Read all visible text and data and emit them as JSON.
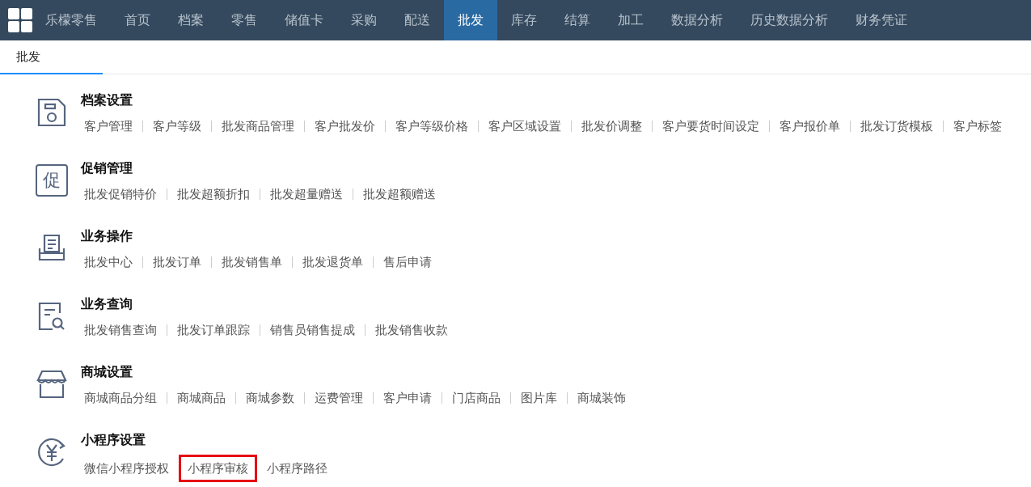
{
  "navbar": {
    "brand": "乐檬零售",
    "items": [
      {
        "label": "首页",
        "selected": false
      },
      {
        "label": "档案",
        "selected": false
      },
      {
        "label": "零售",
        "selected": false
      },
      {
        "label": "储值卡",
        "selected": false
      },
      {
        "label": "采购",
        "selected": false
      },
      {
        "label": "配送",
        "selected": false
      },
      {
        "label": "批发",
        "selected": true
      },
      {
        "label": "库存",
        "selected": false
      },
      {
        "label": "结算",
        "selected": false
      },
      {
        "label": "加工",
        "selected": false
      },
      {
        "label": "数据分析",
        "selected": false
      },
      {
        "label": "历史数据分析",
        "selected": false
      },
      {
        "label": "财务凭证",
        "selected": false
      }
    ]
  },
  "tabs": [
    {
      "label": "批发",
      "selected": true
    }
  ],
  "sections": [
    {
      "kind": "archive",
      "title": "档案设置",
      "separated": true,
      "links": [
        {
          "label": "客户管理",
          "highlighted": false
        },
        {
          "label": "客户等级",
          "highlighted": false
        },
        {
          "label": "批发商品管理",
          "highlighted": false
        },
        {
          "label": "客户批发价",
          "highlighted": false
        },
        {
          "label": "客户等级价格",
          "highlighted": false
        },
        {
          "label": "客户区域设置",
          "highlighted": false
        },
        {
          "label": "批发价调整",
          "highlighted": false
        },
        {
          "label": "客户要货时间设定",
          "highlighted": false
        },
        {
          "label": "客户报价单",
          "highlighted": false
        },
        {
          "label": "批发订货模板",
          "highlighted": false
        },
        {
          "label": "客户标签",
          "highlighted": false
        }
      ]
    },
    {
      "kind": "glyph",
      "icon_text": "促",
      "title": "促销管理",
      "separated": true,
      "links": [
        {
          "label": "批发促销特价",
          "highlighted": false
        },
        {
          "label": "批发超额折扣",
          "highlighted": false
        },
        {
          "label": "批发超量赠送",
          "highlighted": false
        },
        {
          "label": "批发超额赠送",
          "highlighted": false
        }
      ]
    },
    {
      "kind": "tray",
      "title": "业务操作",
      "separated": true,
      "links": [
        {
          "label": "批发中心",
          "highlighted": false
        },
        {
          "label": "批发订单",
          "highlighted": false
        },
        {
          "label": "批发销售单",
          "highlighted": false
        },
        {
          "label": "批发退货单",
          "highlighted": false
        },
        {
          "label": "售后申请",
          "highlighted": false
        }
      ]
    },
    {
      "kind": "query",
      "title": "业务查询",
      "separated": true,
      "links": [
        {
          "label": "批发销售查询",
          "highlighted": false
        },
        {
          "label": "批发订单跟踪",
          "highlighted": false
        },
        {
          "label": "销售员销售提成",
          "highlighted": false
        },
        {
          "label": "批发销售收款",
          "highlighted": false
        }
      ]
    },
    {
      "kind": "store",
      "title": "商城设置",
      "separated": true,
      "links": [
        {
          "label": "商城商品分组",
          "highlighted": false
        },
        {
          "label": "商城商品",
          "highlighted": false
        },
        {
          "label": "商城参数",
          "highlighted": false
        },
        {
          "label": "运费管理",
          "highlighted": false
        },
        {
          "label": "客户申请",
          "highlighted": false
        },
        {
          "label": "门店商品",
          "highlighted": false
        },
        {
          "label": "图片库",
          "highlighted": false
        },
        {
          "label": "商城装饰",
          "highlighted": false
        }
      ]
    },
    {
      "kind": "yuan",
      "title": "小程序设置",
      "separated": false,
      "links": [
        {
          "label": "微信小程序授权",
          "highlighted": false
        },
        {
          "label": "小程序审核",
          "highlighted": true
        },
        {
          "label": "小程序路径",
          "highlighted": false
        }
      ]
    }
  ]
}
